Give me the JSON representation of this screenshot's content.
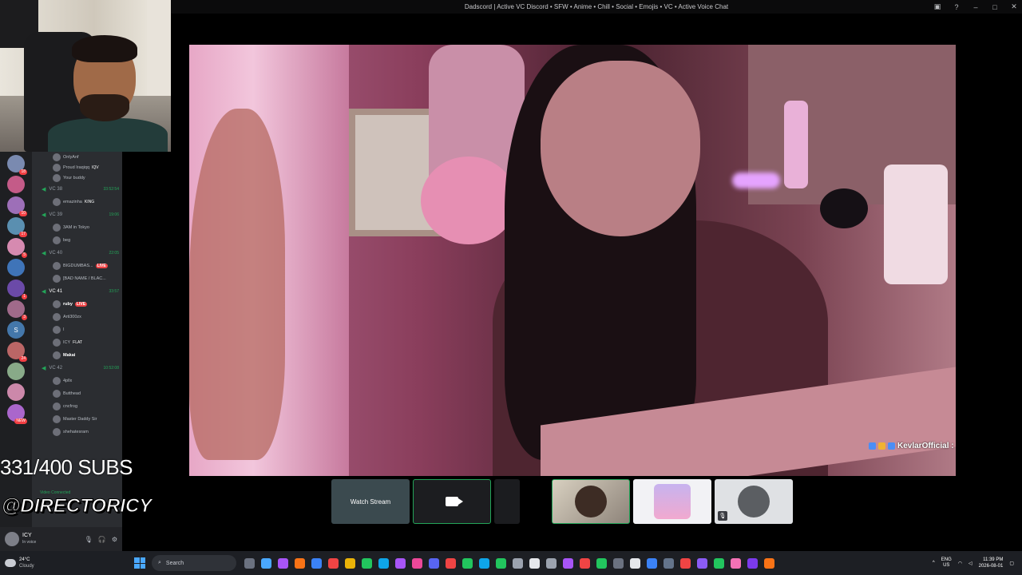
{
  "window": {
    "title": "Dadscord | Active VC Discord • SFW • Anime • Chill • Social • Emojis • VC • Active Voice Chat"
  },
  "overlay": {
    "subs": "331/400 SUBS",
    "handle": "@DIRECTORICY",
    "video_connected": "Video Connected"
  },
  "rail": {
    "servers": [
      {
        "badge": "18"
      },
      {
        "badge": ""
      },
      {
        "badge": "10"
      },
      {
        "badge": "17"
      },
      {
        "badge": "5"
      },
      {
        "badge": ""
      },
      {
        "badge": "1"
      },
      {
        "badge": "3"
      },
      {
        "badge": ""
      },
      {
        "badge": "24"
      },
      {
        "badge": ""
      },
      {
        "badge": ""
      },
      {
        "badge": "NEW"
      }
    ],
    "letter": "S"
  },
  "channels": {
    "top_users": [
      "OnlyAnf",
      "Proud Iraqiqq",
      "Your buddy"
    ],
    "top_user_tag": "IQV",
    "vcs": [
      {
        "name": "VC 38",
        "time": "33:52:54",
        "users": [
          {
            "name": "emazinha",
            "tag": "KING"
          }
        ]
      },
      {
        "name": "VC 39",
        "time": "19:06",
        "users": [
          {
            "name": "3AM in Tokyo",
            "tag": ""
          },
          {
            "name": "beg",
            "tag": ""
          }
        ]
      },
      {
        "name": "VC 40",
        "time": "22:05",
        "users": [
          {
            "name": "BIGDUMBAS...",
            "tag": "LIVE"
          },
          {
            "name": "[BAD NAME / BLAC...",
            "tag": ""
          }
        ]
      },
      {
        "name": "VC 41",
        "time": "33:57",
        "users": [
          {
            "name": "ruby",
            "tag": "LIVE"
          },
          {
            "name": "Arti300zx",
            "tag": ""
          },
          {
            "name": "I",
            "tag": ""
          },
          {
            "name": "ICY",
            "tag": "FLAT"
          },
          {
            "name": "Makai",
            "tag": ""
          }
        ]
      },
      {
        "name": "VC 42",
        "time": "10:52:08",
        "users": [
          {
            "name": "4pllx",
            "tag": ""
          },
          {
            "name": "Butthead",
            "tag": ""
          },
          {
            "name": "cncfrog",
            "tag": ""
          },
          {
            "name": "Master Daddy Sir",
            "tag": ""
          },
          {
            "name": "shehatesram",
            "tag": ""
          }
        ]
      }
    ]
  },
  "user_panel": {
    "name": "ICY",
    "status": "In voice"
  },
  "stream": {
    "name_tag": "KevlarOfficial :"
  },
  "tiles": {
    "watch_label": "Watch Stream"
  },
  "taskbar": {
    "temp": "24°C",
    "condition": "Cloudy",
    "search_placeholder": "Search",
    "lang1": "ENG",
    "lang2": "US",
    "time": "11:39 PM",
    "date": "2026-08-01",
    "apps": [
      "#6b7280",
      "#4aa8ff",
      "#a855f7",
      "#f97316",
      "#3b82f6",
      "#ef4444",
      "#eab308",
      "#22c55e",
      "#0ea5e9",
      "#a855f7",
      "#ec4899",
      "#5865f2",
      "#ef4444",
      "#22c55e",
      "#0ea5e9",
      "#22c55e",
      "#9ca3af",
      "#e5e7eb",
      "#9ca3af",
      "#a855f7",
      "#ef4444",
      "#22c55e",
      "#6b7280",
      "#e5e7eb",
      "#3b82f6",
      "#64748b",
      "#ef4444",
      "#8b5cf6",
      "#22c55e",
      "#f472b6",
      "#7c3aed",
      "#f97316"
    ]
  },
  "colors": {
    "discord_green": "#23a559",
    "live_red": "#ed4245"
  }
}
